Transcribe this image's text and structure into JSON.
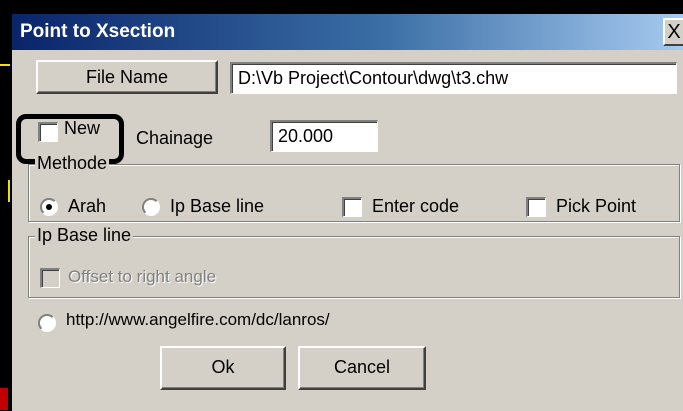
{
  "window": {
    "title": "Point to Xsection",
    "close_glyph": "X"
  },
  "file": {
    "button_label": "File Name",
    "path_value": "D:\\Vb Project\\Contour\\dwg\\t3.chw"
  },
  "new_checkbox": {
    "label": "New",
    "checked": false
  },
  "chainage": {
    "label": "Chainage",
    "value": "20.000"
  },
  "methode": {
    "title": "Methode",
    "options": [
      {
        "label": "Arah",
        "type": "radio",
        "selected": true
      },
      {
        "label": "Ip Base line",
        "type": "radio",
        "selected": false
      },
      {
        "label": "Enter code",
        "type": "checkbox",
        "checked": false
      },
      {
        "label": "Pick Point",
        "type": "checkbox",
        "checked": false
      }
    ]
  },
  "ip_base_line": {
    "title": "Ip Base line",
    "offset_label": "Offset to right angle",
    "offset_enabled": false
  },
  "url_option": {
    "label": "http://www.angelfire.com/dc/lanros/",
    "selected": false
  },
  "buttons": {
    "ok": "Ok",
    "cancel": "Cancel"
  },
  "colors": {
    "titlebar_start": "#0a246a",
    "titlebar_end": "#a6caf0",
    "dialog_bg": "#d4d0c8",
    "highlight": "#000000"
  }
}
